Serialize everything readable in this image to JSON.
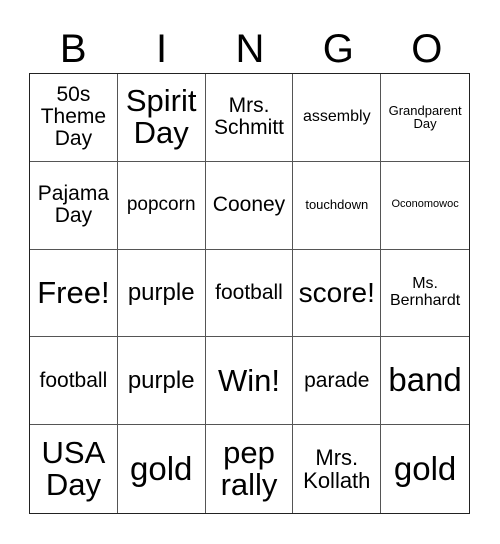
{
  "header": {
    "letters": [
      "B",
      "I",
      "N",
      "G",
      "O"
    ]
  },
  "cells": [
    "50s Theme Day",
    "Spirit Day",
    "Mrs. Schmitt",
    "assembly",
    "Grandparent Day",
    "Pajama Day",
    "popcorn",
    "Cooney",
    "touchdown",
    "Oconomowoc",
    "Free!",
    "purple",
    "football",
    "score!",
    "Ms. Bernhardt",
    "football",
    "purple",
    "Win!",
    "parade",
    "band",
    "USA Day",
    "gold",
    "pep rally",
    "Mrs. Kollath",
    "gold"
  ]
}
